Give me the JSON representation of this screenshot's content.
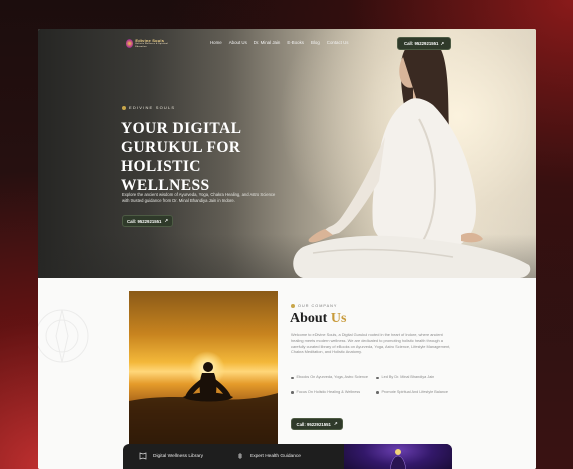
{
  "nav": {
    "logo_text": "Edivine Souls",
    "logo_sub": "Holistic Wellness & Spiritual Education",
    "menu": [
      "Home",
      "About Us",
      "Dr. Minal Jain",
      "E-Books",
      "Blog",
      "Contact Us"
    ],
    "call_label": "Call: 9522921551"
  },
  "hero": {
    "tag": "EDIVINE SOULS",
    "title_lines": [
      "YOUR DIGITAL",
      "GURUKUL FOR",
      "HOLISTIC WELLNESS"
    ],
    "description": "Explore the ancient wisdom of Ayurveda, Yoga, Chakra Healing, and Astro Science with trusted guidance from Dr. Minal Bhandiya Jain in Indore.",
    "call_label": "Call: 9522921551"
  },
  "about": {
    "eyebrow": "OUR COMPANY",
    "title_main": "About",
    "title_accent": "Us",
    "text": "Welcome to eDivine Souls, a Digital Gurukul rooted in the heart of Indore, where ancient healing meets modern wellness. We are dedicated to promoting holistic health through a carefully curated library of eBooks on Ayurveda, Yoga, Astro Science, Lifestyle Management, Chakra Meditation, and Holistic Anatomy.",
    "bullets": [
      "Ebooks On Ayurveda, Yoga, Astro Science",
      "Led By Dr. Minal Bhandiya Jain",
      "Focus On Holistic Healing & Wellness",
      "Promote Spiritual And Lifestyle Balance"
    ],
    "call_label": "Call: 9522921551"
  },
  "cards": [
    {
      "label": "Digital Wellness Library",
      "icon": "book-icon"
    },
    {
      "label": "Expert Health Guidance",
      "icon": "health-icon"
    }
  ],
  "colors": {
    "accent_gold": "#c89a3a",
    "button_green": "#2f3a2a",
    "backdrop_red": "#c03030"
  }
}
